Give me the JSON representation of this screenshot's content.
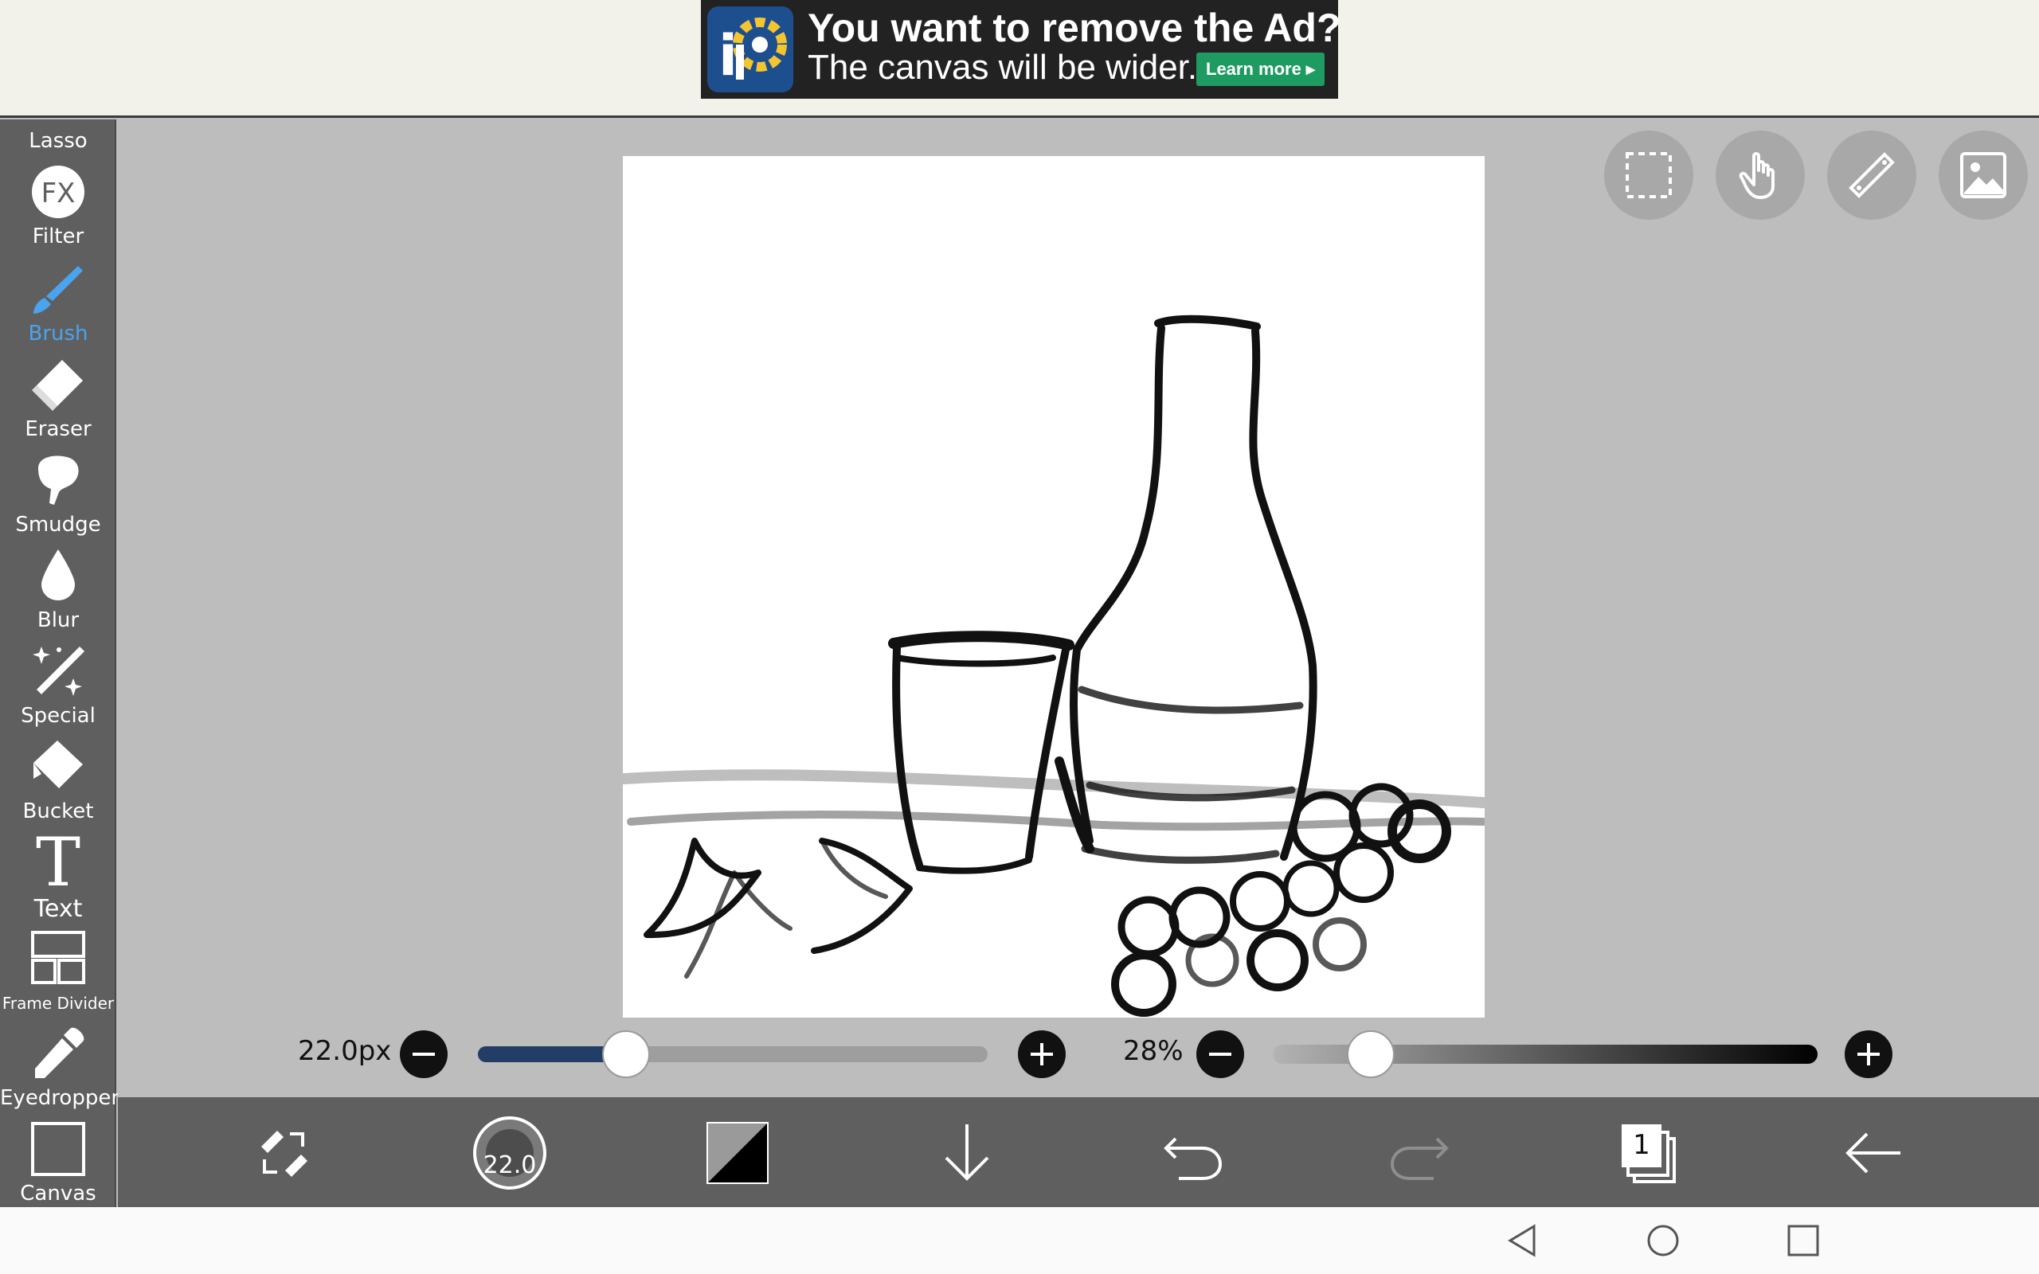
{
  "ad": {
    "title": "You want to remove the Ad?",
    "subtitle": "The canvas will be wider.",
    "cta": "Learn more ▸"
  },
  "toolbar": {
    "items": [
      {
        "label": "Lasso",
        "icon": "lasso-icon"
      },
      {
        "label": "Filter",
        "icon": "fx-icon"
      },
      {
        "label": "Brush",
        "icon": "brush-icon",
        "active": true
      },
      {
        "label": "Eraser",
        "icon": "eraser-icon"
      },
      {
        "label": "Smudge",
        "icon": "smudge-icon"
      },
      {
        "label": "Blur",
        "icon": "blur-drop-icon"
      },
      {
        "label": "Special",
        "icon": "magic-wand-icon"
      },
      {
        "label": "Bucket",
        "icon": "bucket-icon"
      },
      {
        "label": "Text",
        "icon": "text-icon"
      },
      {
        "label": "Frame Divider",
        "icon": "frame-divider-icon"
      },
      {
        "label": "Eyedropper",
        "icon": "eyedropper-icon"
      },
      {
        "label": "Canvas",
        "icon": "canvas-icon"
      }
    ],
    "accent": "#4aa3ee"
  },
  "top_buttons": [
    "selection-icon",
    "hand-gesture-icon",
    "ruler-icon",
    "material-icon"
  ],
  "brush_size": {
    "label": "22.0px",
    "value": 22.0,
    "fraction": 0.29,
    "fill_color": "#223e66"
  },
  "opacity": {
    "label": "28%",
    "value": 28,
    "fraction": 0.18
  },
  "bottom_bar": {
    "brush_preview_label": "22.0",
    "layer_count": "1",
    "icons": [
      "transform-icon",
      "brush-preview-icon",
      "color-swatch-icon",
      "download-icon",
      "undo-icon",
      "redo-icon",
      "layers-icon",
      "back-arrow-icon"
    ]
  },
  "nav": [
    "nav-back-icon",
    "nav-home-icon",
    "nav-recents-icon"
  ]
}
